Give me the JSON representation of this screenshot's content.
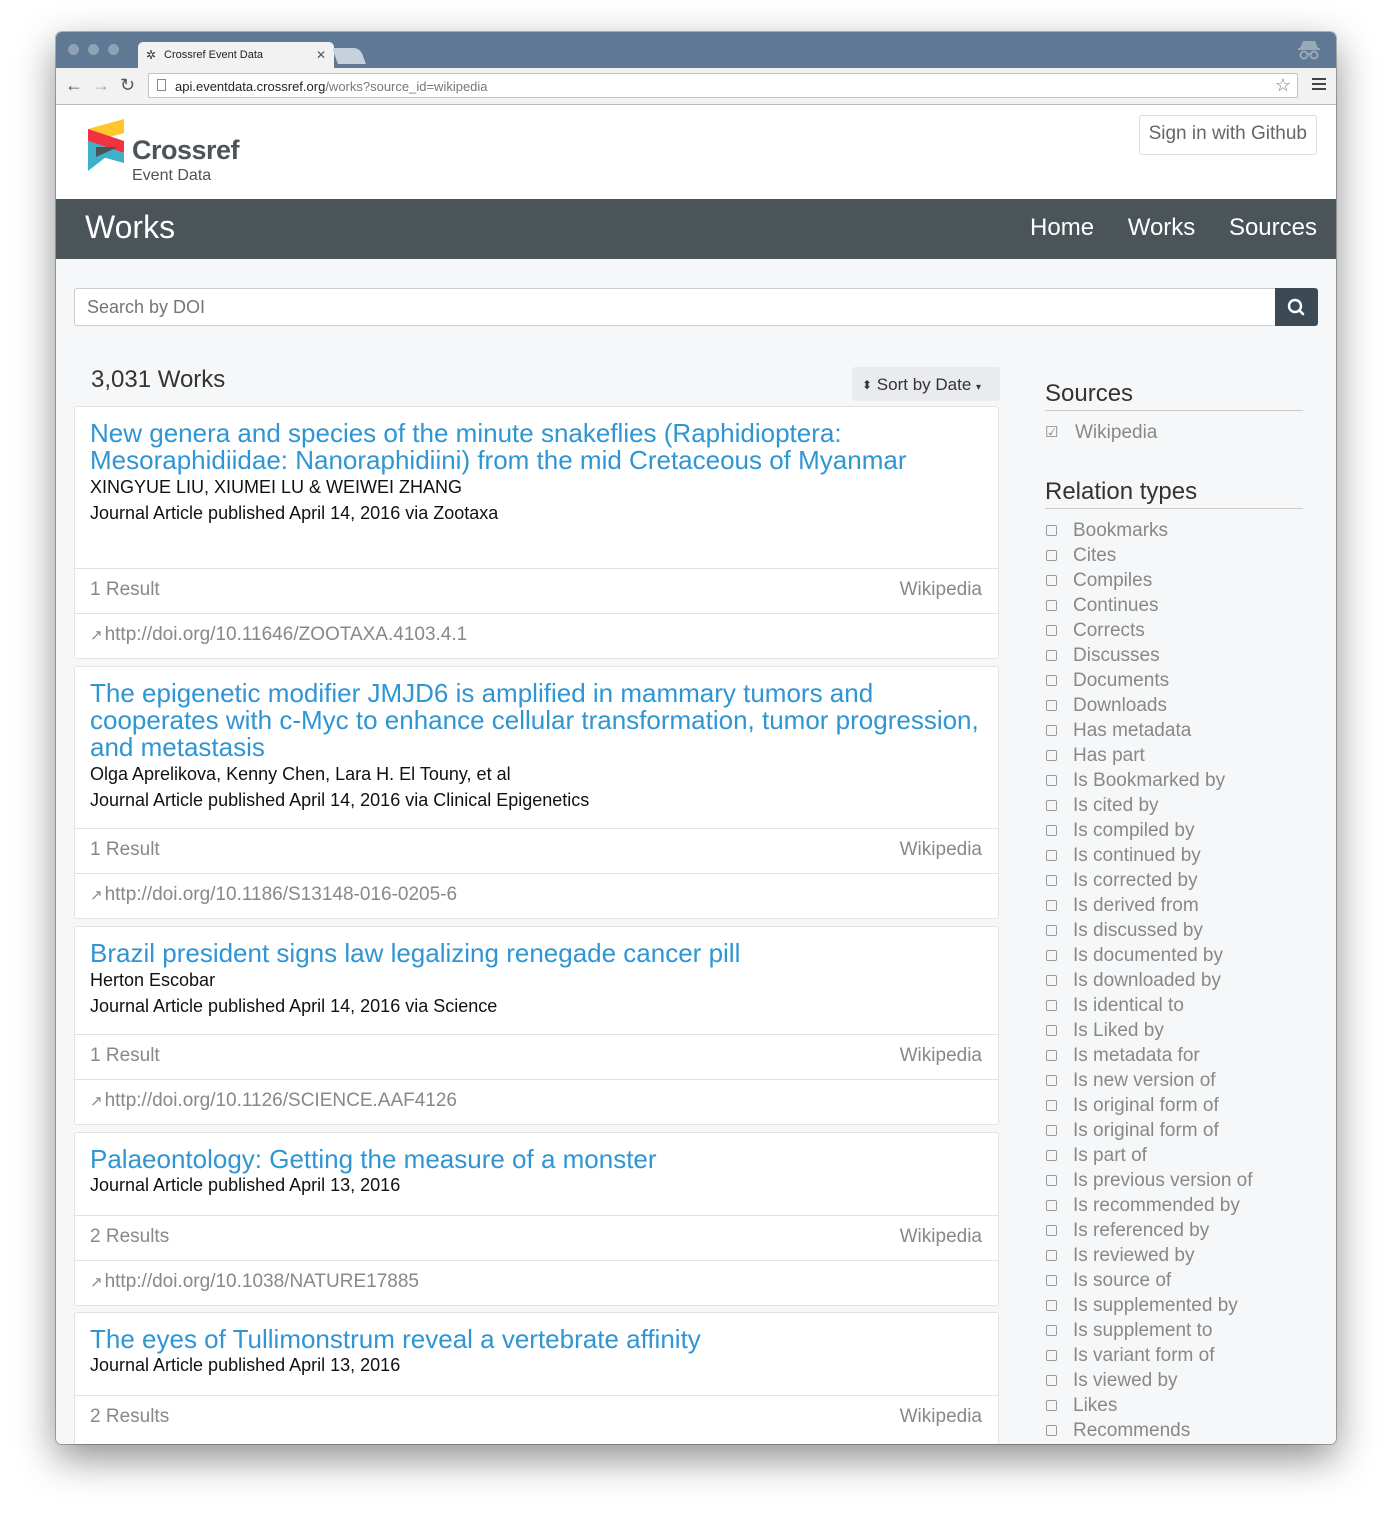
{
  "browser": {
    "tab_title": "Crossref Event Data",
    "url_host": "api.eventdata.crossref.org",
    "url_path": "/works?source_id=wikipedia"
  },
  "header": {
    "logo_word": "Crossref",
    "logo_sub": "Event Data",
    "signin_label": "Sign in with Github"
  },
  "navbar": {
    "title": "Works",
    "links": [
      "Home",
      "Works",
      "Sources"
    ]
  },
  "search": {
    "placeholder": "Search by DOI"
  },
  "results": {
    "count_label": "3,031 Works",
    "sort_label": "Sort by Date"
  },
  "works": [
    {
      "title": "New genera and species of the minute snakeflies (Raphidioptera: Mesoraphidiidae: Nanoraphidiini) from the mid Cretaceous of Myanmar",
      "authors": "XINGYUE LIU, XIUMEI LU & WEIWEI ZHANG",
      "meta": "Journal Article published April 14, 2016 via Zootaxa",
      "results": "1 Result",
      "source": "Wikipedia",
      "doi": "http://doi.org/10.11646/ZOOTAXA.4103.4.1"
    },
    {
      "title": "The epigenetic modifier JMJD6 is amplified in mammary tumors and cooperates with c-Myc to enhance cellular transformation, tumor progression, and metastasis",
      "authors": "Olga Aprelikova, Kenny Chen, Lara H. El Touny, et al",
      "meta": "Journal Article published April 14, 2016 via Clinical Epigenetics",
      "results": "1 Result",
      "source": "Wikipedia",
      "doi": "http://doi.org/10.1186/S13148-016-0205-6"
    },
    {
      "title": "Brazil president signs law legalizing renegade cancer pill",
      "authors": "Herton Escobar",
      "meta": "Journal Article published April 14, 2016 via Science",
      "results": "1 Result",
      "source": "Wikipedia",
      "doi": "http://doi.org/10.1126/SCIENCE.AAF4126"
    },
    {
      "title": "Palaeontology: Getting the measure of a monster",
      "authors": "",
      "meta": "Journal Article published April 13, 2016",
      "results": "2 Results",
      "source": "Wikipedia",
      "doi": "http://doi.org/10.1038/NATURE17885"
    },
    {
      "title": "The eyes of Tullimonstrum reveal a vertebrate affinity",
      "authors": "",
      "meta": "Journal Article published April 13, 2016",
      "results": "2 Results",
      "source": "Wikipedia",
      "doi": ""
    }
  ],
  "sidebar": {
    "sources_heading": "Sources",
    "sources": [
      {
        "label": "Wikipedia",
        "checked": true
      }
    ],
    "relations_heading": "Relation types",
    "relations": [
      "Bookmarks",
      "Cites",
      "Compiles",
      "Continues",
      "Corrects",
      "Discusses",
      "Documents",
      "Downloads",
      "Has metadata",
      "Has part",
      "Is Bookmarked by",
      "Is cited by",
      "Is compiled by",
      "Is continued by",
      "Is corrected by",
      "Is derived from",
      "Is discussed by",
      "Is documented by",
      "Is downloaded by",
      "Is identical to",
      "Is Liked by",
      "Is metadata for",
      "Is new version of",
      "Is original form of",
      "Is original form of",
      "Is part of",
      "Is previous version of",
      "Is recommended by",
      "Is referenced by",
      "Is reviewed by",
      "Is source of",
      "Is supplemented by",
      "Is supplement to",
      "Is variant form of",
      "Is viewed by",
      "Likes",
      "Recommends"
    ]
  },
  "colors": {
    "navbar_bg": "#4a5459",
    "link": "#2f95d3",
    "search_button": "#3c4a55",
    "chrome_titlebar": "#5f7893"
  }
}
